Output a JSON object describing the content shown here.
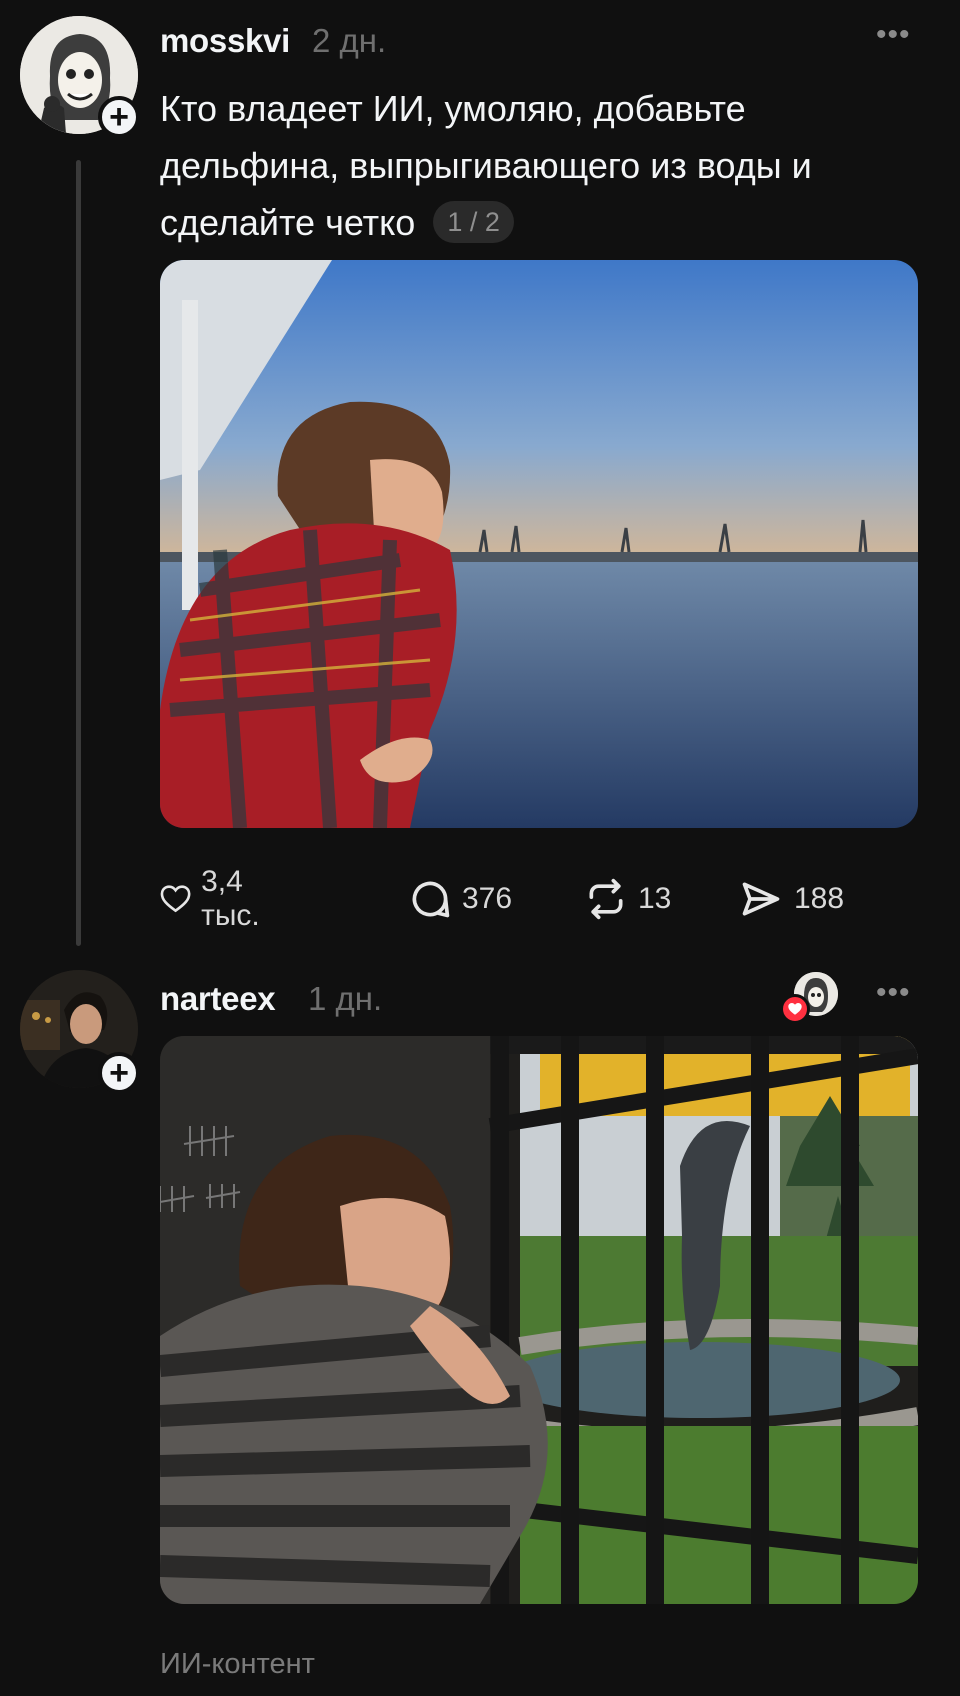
{
  "post1": {
    "username": "mosskvi",
    "time": "2 дн.",
    "text": "Кто владеет ИИ, умоляю, добавьте дельфина, выпрыгивающего из воды и сделайте четко",
    "media_counter": "1 / 2",
    "likes": "3,4 тыс.",
    "comments": "376",
    "reposts": "13",
    "shares": "188"
  },
  "post2": {
    "username": "narteex",
    "time": "1 дн.",
    "label": "ИИ-контент"
  },
  "icons": {
    "follow": "plus-icon",
    "more": "ellipsis-icon",
    "like": "heart-icon",
    "comment": "speech-bubble-icon",
    "repost": "repost-icon",
    "share": "send-icon"
  },
  "colors": {
    "background": "#101010",
    "text": "#f3f5f7",
    "muted": "#6f6f6f",
    "like_badge": "#ff3040"
  }
}
